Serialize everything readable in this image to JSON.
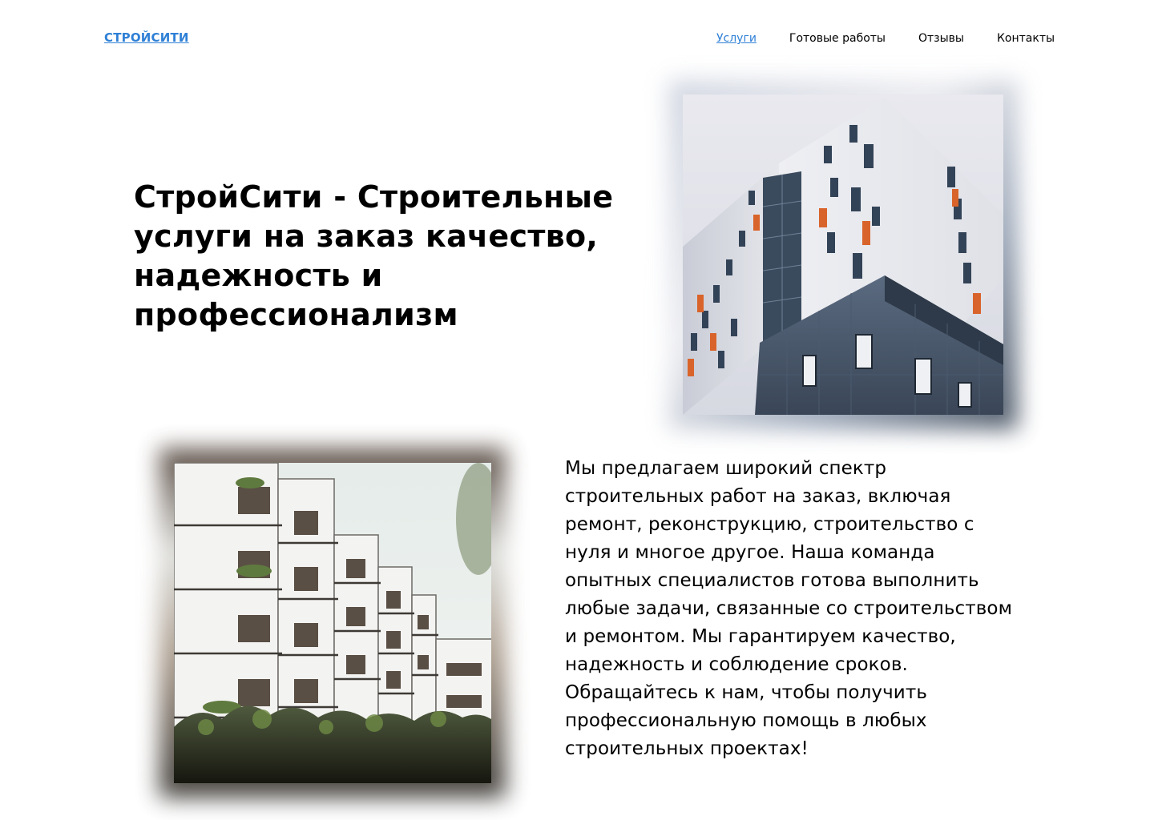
{
  "header": {
    "logo": "СТРОЙСИТИ",
    "nav": [
      {
        "label": "Услуги",
        "active": true
      },
      {
        "label": "Готовые работы",
        "active": false
      },
      {
        "label": "Отзывы",
        "active": false
      },
      {
        "label": "Контакты",
        "active": false
      }
    ]
  },
  "hero": {
    "title": "СтройСити - Строительные услуги на заказ качество, надежность и профессионализм"
  },
  "about": {
    "text": "Мы предлагаем широкий спектр строительных работ на заказ, включая ремонт, реконструкцию, строительство с нуля и многое другое. Наша команда опытных специалистов готова выполнить любые задачи, связанные со строительством и ремонтом. Мы гарантируем качество, надежность и соблюдение сроков. Обращайтесь к нам, чтобы получить профессиональную помощь в любых строительных проектах!"
  },
  "colors": {
    "accent": "#2f80d6",
    "text": "#000000",
    "background": "#ffffff"
  }
}
